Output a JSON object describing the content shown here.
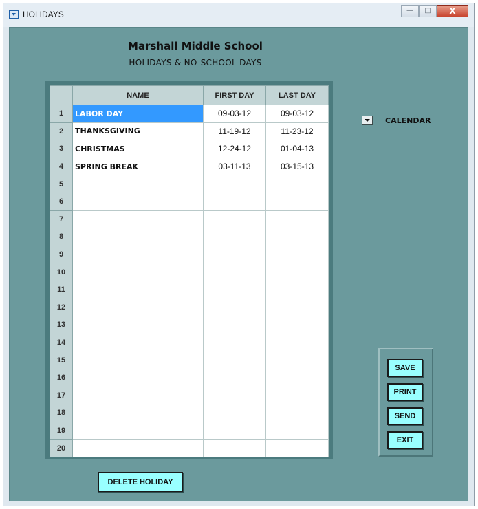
{
  "window": {
    "title": "HOLIDAYS",
    "controls": {
      "minimize": "—",
      "maximize": "□",
      "close": "X"
    }
  },
  "header": {
    "school_name": "Marshall Middle School",
    "subtitle": "HOLIDAYS & NO-SCHOOL DAYS"
  },
  "grid": {
    "columns": {
      "name": "NAME",
      "first_day": "FIRST DAY",
      "last_day": "LAST DAY"
    },
    "rows": [
      {
        "num": "1",
        "name": "LABOR DAY",
        "first": "09-03-12",
        "last": "09-03-12"
      },
      {
        "num": "2",
        "name": "THANKSGIVING",
        "first": "11-19-12",
        "last": "11-23-12"
      },
      {
        "num": "3",
        "name": "CHRISTMAS",
        "first": "12-24-12",
        "last": "01-04-13"
      },
      {
        "num": "4",
        "name": "SPRING BREAK",
        "first": "03-11-13",
        "last": "03-15-13"
      },
      {
        "num": "5",
        "name": "",
        "first": "",
        "last": ""
      },
      {
        "num": "6",
        "name": "",
        "first": "",
        "last": ""
      },
      {
        "num": "7",
        "name": "",
        "first": "",
        "last": ""
      },
      {
        "num": "8",
        "name": "",
        "first": "",
        "last": ""
      },
      {
        "num": "9",
        "name": "",
        "first": "",
        "last": ""
      },
      {
        "num": "10",
        "name": "",
        "first": "",
        "last": ""
      },
      {
        "num": "11",
        "name": "",
        "first": "",
        "last": ""
      },
      {
        "num": "12",
        "name": "",
        "first": "",
        "last": ""
      },
      {
        "num": "13",
        "name": "",
        "first": "",
        "last": ""
      },
      {
        "num": "14",
        "name": "",
        "first": "",
        "last": ""
      },
      {
        "num": "15",
        "name": "",
        "first": "",
        "last": ""
      },
      {
        "num": "16",
        "name": "",
        "first": "",
        "last": ""
      },
      {
        "num": "17",
        "name": "",
        "first": "",
        "last": ""
      },
      {
        "num": "18",
        "name": "",
        "first": "",
        "last": ""
      },
      {
        "num": "19",
        "name": "",
        "first": "",
        "last": ""
      },
      {
        "num": "20",
        "name": "",
        "first": "",
        "last": ""
      }
    ]
  },
  "calendar": {
    "label": "CALENDAR"
  },
  "buttons": {
    "save": "SAVE",
    "print": "PRINT",
    "send": "SEND",
    "exit": "EXIT",
    "delete": "DELETE HOLIDAY"
  },
  "colors": {
    "background": "#6b9a9d",
    "button": "#99ffff",
    "selection": "#3399ff",
    "grid_header": "#c3d5d6"
  }
}
